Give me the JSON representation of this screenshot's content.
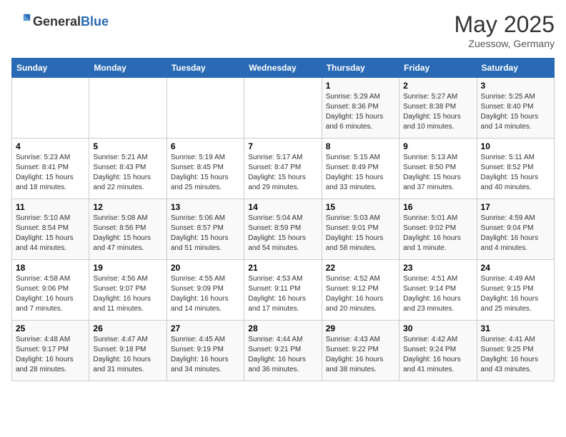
{
  "header": {
    "logo_general": "General",
    "logo_blue": "Blue",
    "month_title": "May 2025",
    "location": "Zuessow, Germany"
  },
  "columns": [
    "Sunday",
    "Monday",
    "Tuesday",
    "Wednesday",
    "Thursday",
    "Friday",
    "Saturday"
  ],
  "weeks": [
    [
      {
        "day": "",
        "info": ""
      },
      {
        "day": "",
        "info": ""
      },
      {
        "day": "",
        "info": ""
      },
      {
        "day": "",
        "info": ""
      },
      {
        "day": "1",
        "info": "Sunrise: 5:29 AM\nSunset: 8:36 PM\nDaylight: 15 hours\nand 6 minutes."
      },
      {
        "day": "2",
        "info": "Sunrise: 5:27 AM\nSunset: 8:38 PM\nDaylight: 15 hours\nand 10 minutes."
      },
      {
        "day": "3",
        "info": "Sunrise: 5:25 AM\nSunset: 8:40 PM\nDaylight: 15 hours\nand 14 minutes."
      }
    ],
    [
      {
        "day": "4",
        "info": "Sunrise: 5:23 AM\nSunset: 8:41 PM\nDaylight: 15 hours\nand 18 minutes."
      },
      {
        "day": "5",
        "info": "Sunrise: 5:21 AM\nSunset: 8:43 PM\nDaylight: 15 hours\nand 22 minutes."
      },
      {
        "day": "6",
        "info": "Sunrise: 5:19 AM\nSunset: 8:45 PM\nDaylight: 15 hours\nand 25 minutes."
      },
      {
        "day": "7",
        "info": "Sunrise: 5:17 AM\nSunset: 8:47 PM\nDaylight: 15 hours\nand 29 minutes."
      },
      {
        "day": "8",
        "info": "Sunrise: 5:15 AM\nSunset: 8:49 PM\nDaylight: 15 hours\nand 33 minutes."
      },
      {
        "day": "9",
        "info": "Sunrise: 5:13 AM\nSunset: 8:50 PM\nDaylight: 15 hours\nand 37 minutes."
      },
      {
        "day": "10",
        "info": "Sunrise: 5:11 AM\nSunset: 8:52 PM\nDaylight: 15 hours\nand 40 minutes."
      }
    ],
    [
      {
        "day": "11",
        "info": "Sunrise: 5:10 AM\nSunset: 8:54 PM\nDaylight: 15 hours\nand 44 minutes."
      },
      {
        "day": "12",
        "info": "Sunrise: 5:08 AM\nSunset: 8:56 PM\nDaylight: 15 hours\nand 47 minutes."
      },
      {
        "day": "13",
        "info": "Sunrise: 5:06 AM\nSunset: 8:57 PM\nDaylight: 15 hours\nand 51 minutes."
      },
      {
        "day": "14",
        "info": "Sunrise: 5:04 AM\nSunset: 8:59 PM\nDaylight: 15 hours\nand 54 minutes."
      },
      {
        "day": "15",
        "info": "Sunrise: 5:03 AM\nSunset: 9:01 PM\nDaylight: 15 hours\nand 58 minutes."
      },
      {
        "day": "16",
        "info": "Sunrise: 5:01 AM\nSunset: 9:02 PM\nDaylight: 16 hours\nand 1 minute."
      },
      {
        "day": "17",
        "info": "Sunrise: 4:59 AM\nSunset: 9:04 PM\nDaylight: 16 hours\nand 4 minutes."
      }
    ],
    [
      {
        "day": "18",
        "info": "Sunrise: 4:58 AM\nSunset: 9:06 PM\nDaylight: 16 hours\nand 7 minutes."
      },
      {
        "day": "19",
        "info": "Sunrise: 4:56 AM\nSunset: 9:07 PM\nDaylight: 16 hours\nand 11 minutes."
      },
      {
        "day": "20",
        "info": "Sunrise: 4:55 AM\nSunset: 9:09 PM\nDaylight: 16 hours\nand 14 minutes."
      },
      {
        "day": "21",
        "info": "Sunrise: 4:53 AM\nSunset: 9:11 PM\nDaylight: 16 hours\nand 17 minutes."
      },
      {
        "day": "22",
        "info": "Sunrise: 4:52 AM\nSunset: 9:12 PM\nDaylight: 16 hours\nand 20 minutes."
      },
      {
        "day": "23",
        "info": "Sunrise: 4:51 AM\nSunset: 9:14 PM\nDaylight: 16 hours\nand 23 minutes."
      },
      {
        "day": "24",
        "info": "Sunrise: 4:49 AM\nSunset: 9:15 PM\nDaylight: 16 hours\nand 25 minutes."
      }
    ],
    [
      {
        "day": "25",
        "info": "Sunrise: 4:48 AM\nSunset: 9:17 PM\nDaylight: 16 hours\nand 28 minutes."
      },
      {
        "day": "26",
        "info": "Sunrise: 4:47 AM\nSunset: 9:18 PM\nDaylight: 16 hours\nand 31 minutes."
      },
      {
        "day": "27",
        "info": "Sunrise: 4:45 AM\nSunset: 9:19 PM\nDaylight: 16 hours\nand 34 minutes."
      },
      {
        "day": "28",
        "info": "Sunrise: 4:44 AM\nSunset: 9:21 PM\nDaylight: 16 hours\nand 36 minutes."
      },
      {
        "day": "29",
        "info": "Sunrise: 4:43 AM\nSunset: 9:22 PM\nDaylight: 16 hours\nand 38 minutes."
      },
      {
        "day": "30",
        "info": "Sunrise: 4:42 AM\nSunset: 9:24 PM\nDaylight: 16 hours\nand 41 minutes."
      },
      {
        "day": "31",
        "info": "Sunrise: 4:41 AM\nSunset: 9:25 PM\nDaylight: 16 hours\nand 43 minutes."
      }
    ]
  ]
}
